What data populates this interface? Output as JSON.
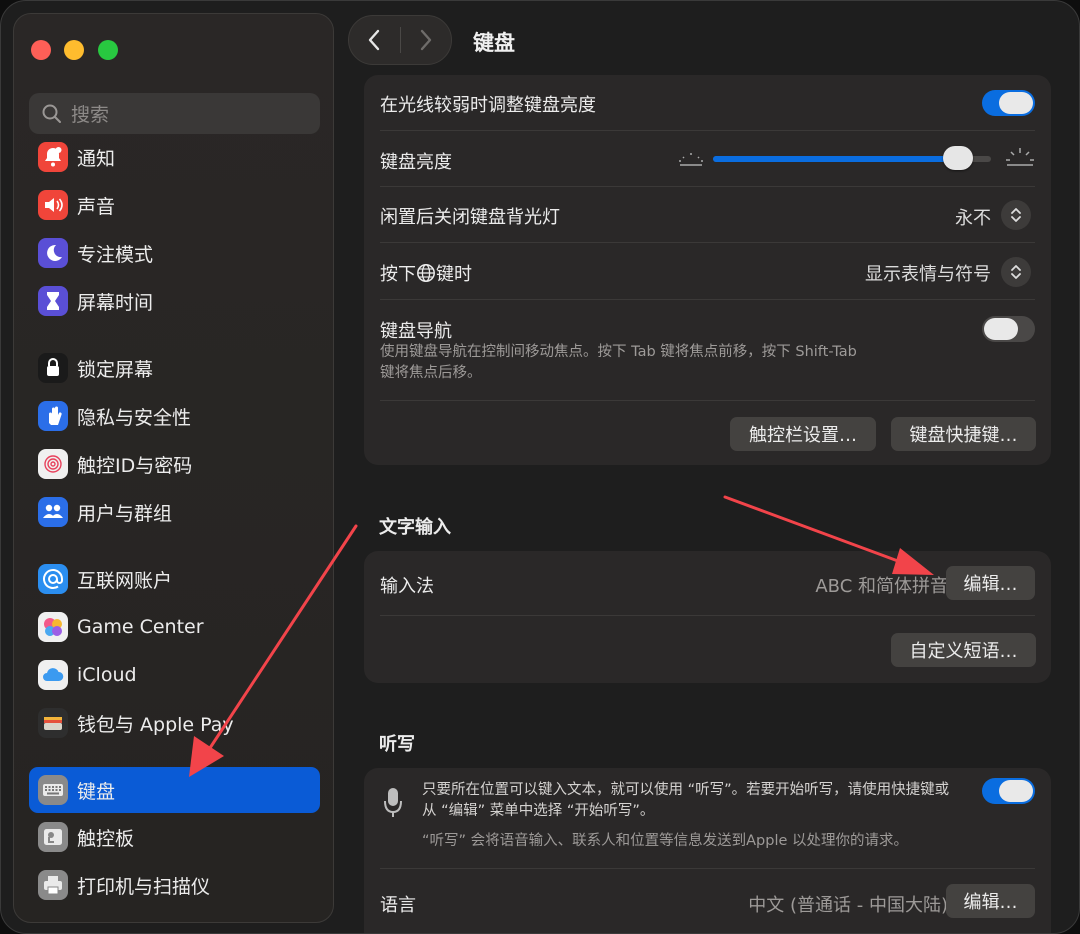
{
  "window": {
    "title": "键盘"
  },
  "sidebar": {
    "search_placeholder": "搜索",
    "items": [
      {
        "label": "通知",
        "icon": "bell-icon",
        "color": "#f0453a"
      },
      {
        "label": "声音",
        "icon": "speaker-icon",
        "color": "#f0453a"
      },
      {
        "label": "专注模式",
        "icon": "moon-icon",
        "color": "#5a4fd6"
      },
      {
        "label": "屏幕时间",
        "icon": "hourglass-icon",
        "color": "#5a4fd6"
      },
      {
        "label": "锁定屏幕",
        "icon": "lock-icon",
        "color": "#1a1a1a"
      },
      {
        "label": "隐私与安全性",
        "icon": "hand-icon",
        "color": "#2b6ee8"
      },
      {
        "label": "触控ID与密码",
        "icon": "fingerprint-icon",
        "color": "#f0f0f0"
      },
      {
        "label": "用户与群组",
        "icon": "users-icon",
        "color": "#2b6ee8"
      },
      {
        "label": "互联网账户",
        "icon": "at-icon",
        "color": "#2b8ef0"
      },
      {
        "label": "Game Center",
        "icon": "game-center-icon",
        "color": "#f0f0f0"
      },
      {
        "label": "iCloud",
        "icon": "cloud-icon",
        "color": "#f0f0f0"
      },
      {
        "label": "钱包与 Apple Pay",
        "icon": "wallet-icon",
        "color": "#2e2e2e"
      },
      {
        "label": "键盘",
        "icon": "keyboard-icon",
        "color": "#8a8a8a",
        "active": true
      },
      {
        "label": "触控板",
        "icon": "trackpad-icon",
        "color": "#8a8a8a"
      },
      {
        "label": "打印机与扫描仪",
        "icon": "printer-icon",
        "color": "#8a8a8a"
      }
    ]
  },
  "keyboard": {
    "backlight_low_light_label": "在光线较弱时调整键盘亮度",
    "backlight_low_light_on": true,
    "brightness_label": "键盘亮度",
    "brightness_level": 0.88,
    "backlight_off_label": "闲置后关闭键盘背光灯",
    "backlight_off_value": "永不",
    "globe_key_label_pre": "按下",
    "globe_key_label_post": "键时",
    "globe_key_value": "显示表情与符号",
    "keyboard_nav_label": "键盘导航",
    "keyboard_nav_on": false,
    "keyboard_nav_desc_1": "使用键盘导航在控制间移动焦点。按下 Tab 键将焦点前移，按下 Shift-Tab",
    "keyboard_nav_desc_2": "键将焦点后移。",
    "touchbar_button": "触控栏设置…",
    "shortcuts_button": "键盘快捷键…"
  },
  "text_input": {
    "heading": "文字输入",
    "input_source_label": "输入法",
    "input_source_value": "ABC 和简体拼音",
    "edit_button": "编辑…",
    "text_replacements_button": "自定义短语…"
  },
  "dictation": {
    "heading": "听写",
    "on": true,
    "desc_1": "只要所在位置可以键入文本，就可以使用 “听写”。若要开始听写，请使用快捷键或",
    "desc_2": "从 “编辑” 菜单中选择 “开始听写”。",
    "privacy_note": "“听写” 会将语音输入、联系人和位置等信息发送到Apple 以处理你的请求。",
    "language_label": "语言",
    "language_value": "中文 (普通话 - 中国大陆)",
    "language_edit_button": "编辑…"
  },
  "colors": {
    "accent": "#0a6de0",
    "sidebar_active": "#0a5bd6",
    "arrow": "#f2444a"
  }
}
